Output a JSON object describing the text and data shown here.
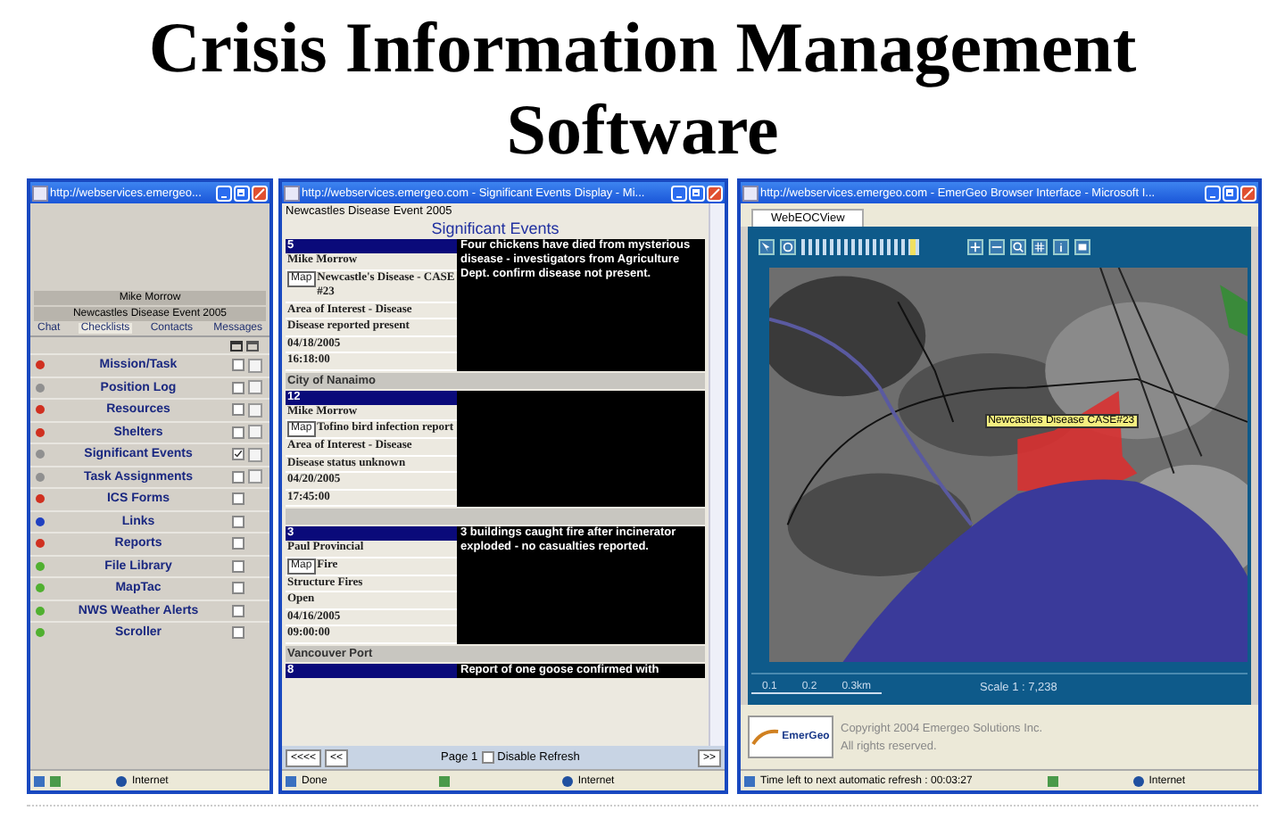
{
  "title": "Crisis Information Management Software",
  "checklist_window": {
    "title": "http://webservices.emergeo...",
    "user": "Mike Morrow",
    "event": "Newcastles Disease Event 2005",
    "tabs": [
      {
        "label": "Chat",
        "selected": false
      },
      {
        "label": "Checklists",
        "selected": true
      },
      {
        "label": "Contacts",
        "selected": false
      },
      {
        "label": "Messages",
        "selected": false
      }
    ],
    "items": [
      {
        "label": "Mission/Task",
        "color": "#d03020",
        "checked": false,
        "popup": true
      },
      {
        "label": "Position Log",
        "color": "#909090",
        "checked": false,
        "popup": true
      },
      {
        "label": "Resources",
        "color": "#d03020",
        "checked": false,
        "popup": true
      },
      {
        "label": "Shelters",
        "color": "#d03020",
        "checked": false,
        "popup": true
      },
      {
        "label": "Significant Events",
        "color": "#909090",
        "checked": true,
        "popup": true
      },
      {
        "label": "Task Assignments",
        "color": "#909090",
        "checked": false,
        "popup": true
      },
      {
        "label": "ICS Forms",
        "color": "#d03020",
        "checked": false,
        "popup": false
      },
      {
        "label": "Links",
        "color": "#2040c0",
        "checked": false,
        "popup": false
      },
      {
        "label": "Reports",
        "color": "#d03020",
        "checked": false,
        "popup": false
      },
      {
        "label": "File Library",
        "color": "#50b030",
        "checked": false,
        "popup": false
      },
      {
        "label": "MapTac",
        "color": "#50b030",
        "checked": false,
        "popup": false
      },
      {
        "label": "NWS Weather Alerts",
        "color": "#50b030",
        "checked": false,
        "popup": false
      },
      {
        "label": "Scroller",
        "color": "#50b030",
        "checked": false,
        "popup": false
      }
    ],
    "status": "Internet"
  },
  "events_window": {
    "title": "http://webservices.emergeo.com - Significant Events Display - Mi...",
    "event": "Newcastles Disease Event 2005",
    "heading": "Significant Events",
    "rows": [
      {
        "kind": "event",
        "id": "5",
        "author": "Mike Morrow",
        "map": "Map",
        "subject": "Newcastle's Disease - CASE #23",
        "fields": [
          "Area of Interest - Disease",
          "Disease reported present",
          "04/18/2005",
          "16:18:00"
        ],
        "description": "Four chickens have died from mysterious disease - investigators from Agriculture Dept. confirm disease not present."
      },
      {
        "kind": "location",
        "label": "City of Nanaimo"
      },
      {
        "kind": "event",
        "id": "12",
        "author": "Mike Morrow",
        "map": "Map",
        "subject": "Tofino bird infection report",
        "fields": [
          "Area of Interest - Disease",
          "Disease status unknown",
          "04/20/2005",
          "17:45:00"
        ]
      },
      {
        "kind": "location"
      },
      {
        "kind": "event",
        "id": "3",
        "author": "Paul Provincial",
        "map": "Map",
        "subject": "Fire",
        "fields": [
          "Structure Fires",
          "Open",
          "04/16/2005",
          "09:00:00"
        ],
        "description": "3 buildings caught fire after incinerator exploded - no casualties reported."
      },
      {
        "kind": "location",
        "label": "Vancouver Port"
      },
      {
        "kind": "event",
        "id": "8",
        "description": "Report of one goose confirmed with"
      }
    ],
    "first": "<<<<",
    "prev": "<<",
    "page": "Page 1",
    "refresh": {
      "label": "Disable Refresh",
      "checked": false
    },
    "next": ">>",
    "status": "Done",
    "zone": "Internet"
  },
  "map_window": {
    "title": "http://webservices.emergeo.com - EmerGeo Browser Interface - Microsoft I...",
    "tab": "WebEOCView",
    "zoom": {
      "level": 0.68
    },
    "overlay_label": "Newcastles Disease CASE#23",
    "scale_ticks": [
      "0.1",
      "0.2",
      "0.3km"
    ],
    "scale": "Scale 1 : 7,238",
    "logo": "EmerGeo",
    "copyright": "Copyright 2004 Emergeo Solutions Inc.",
    "rights": "All rights reserved.",
    "status": "Time left to next automatic refresh : 00:03:27",
    "zone": "Internet"
  }
}
